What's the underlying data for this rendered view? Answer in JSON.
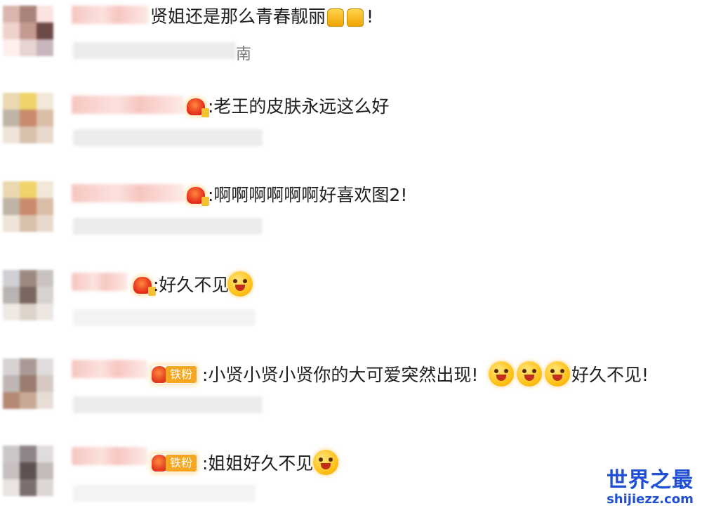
{
  "comments": [
    {
      "text": "贤姐还是那么青春靓丽",
      "text_suffix": "!",
      "location": "南"
    },
    {
      "text": ":老王的皮肤永远这么好"
    },
    {
      "text": ":啊啊啊啊啊啊好喜欢图2!"
    },
    {
      "text": ":好久不见"
    },
    {
      "badge_label": "铁粉",
      "text": ":小贤小贤小贤你的大可爱突然出现!",
      "text_suffix": "好久不见!"
    },
    {
      "badge_label": "铁粉",
      "text": ":姐姐好久不见"
    }
  ],
  "icons": {
    "thumbs_up": "thumbs-up-icon",
    "heart_badge": "fan-heart-badge-icon",
    "smile_emoji": "smile-emoji-icon"
  },
  "watermark": {
    "title": "世界之最",
    "url": "shijiezz.com"
  },
  "colors": {
    "name_blur": "#f7c6c0",
    "fan_badge": "#f5a623",
    "watermark": "#1f4fd6"
  }
}
